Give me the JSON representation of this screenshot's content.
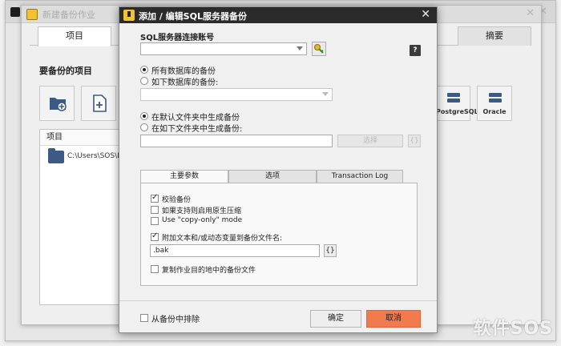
{
  "background_windows": {
    "far": {},
    "mid": {
      "title": "新建备份作业",
      "tabs": {
        "items": [
          "项目",
          "摘要"
        ]
      },
      "section_title": "要备份的项目",
      "tiles": [
        {
          "name": "folder-add",
          "caption": ""
        },
        {
          "name": "file-add",
          "caption": ""
        },
        {
          "name": "postgresql",
          "caption": "PostgreSQL"
        },
        {
          "name": "oracle",
          "caption": "Oracle"
        }
      ],
      "list_header": "项目",
      "list_row_path": "C:\\Users\\SOS\\Desk"
    }
  },
  "dialog": {
    "title": "添加 / 编辑SQL服务器备份",
    "connection_label": "SQL服务器连接账号",
    "connection_value": "",
    "databases": {
      "all_label": "所有数据库的备份",
      "these_label": "如下数据库的备份:",
      "selected": "all"
    },
    "folder": {
      "default_label": "在默认文件夹中生成备份",
      "custom_label": "在如下文件夹中生成备份:",
      "selected": "default",
      "browse_label": "选择",
      "path_value": ""
    },
    "tabs": {
      "general": "主要参数",
      "options": "选项",
      "log": "Transaction Log",
      "active": "general"
    },
    "general": {
      "verify_label": "校验备份",
      "verify_checked": true,
      "compress_label": "如果支持则启用原生压缩",
      "compress_checked": false,
      "copyonly_label": "Use \"copy-only\" mode",
      "copyonly_checked": false,
      "append_label": "附加文本和/或动态变量到备份文件名:",
      "append_checked": true,
      "append_value": ".bak",
      "brace_label": "{}",
      "copy_label": "复制作业目的地中的备份文件",
      "copy_checked": false
    },
    "exclude_label": "从备份中排除",
    "exclude_checked": false,
    "ok_label": "确定",
    "cancel_label": "取消"
  },
  "colors": {
    "cancel_accent": "#f27a4f",
    "title_bar": "#2b2b2b",
    "folder_icon": "#3d5a85"
  },
  "watermark": "软件SOS"
}
